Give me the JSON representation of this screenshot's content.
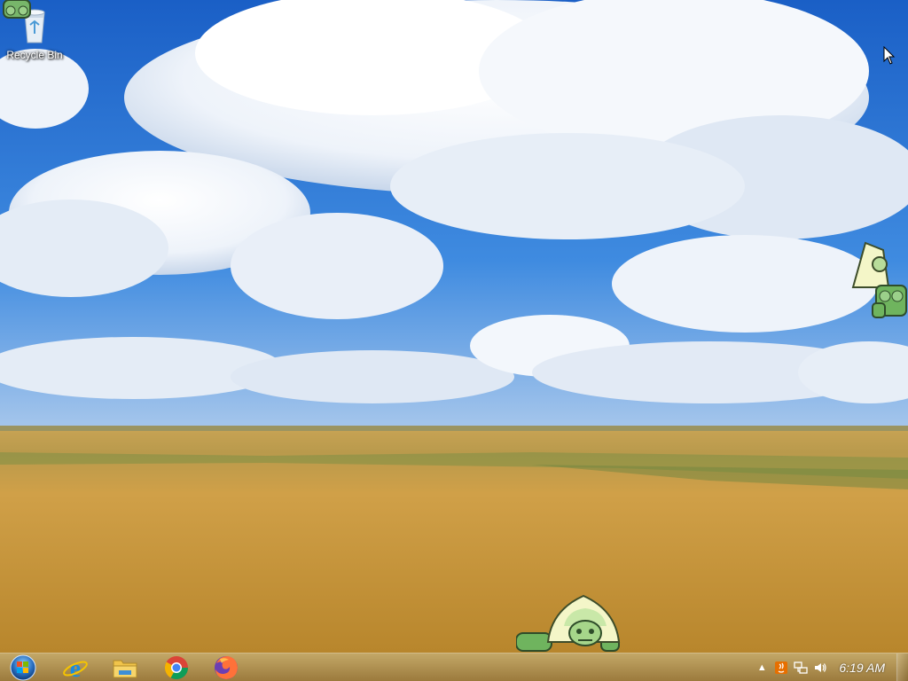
{
  "desktop": {
    "icons": [
      {
        "label": "Recycle Bin",
        "icon": "recycle-bin-icon"
      }
    ],
    "mascots": [
      "peridot-sticker-top-left",
      "peridot-sticker-right",
      "peridot-sticker-bottom"
    ]
  },
  "taskbar": {
    "start_icon": "windows-start-orb-icon",
    "pinned": [
      {
        "name": "Internet Explorer",
        "icon": "internet-explorer-icon"
      },
      {
        "name": "File Explorer",
        "icon": "folder-icon"
      },
      {
        "name": "Google Chrome",
        "icon": "chrome-icon"
      },
      {
        "name": "Firefox",
        "icon": "firefox-icon"
      }
    ],
    "tray": {
      "chevron": "▲",
      "items": [
        "java-update-icon",
        "network-icon",
        "volume-icon"
      ],
      "clock": "6:19 AM"
    }
  },
  "colors": {
    "sky": "#2e77d8",
    "field": "#c0902f",
    "taskbar": "#a88544"
  }
}
